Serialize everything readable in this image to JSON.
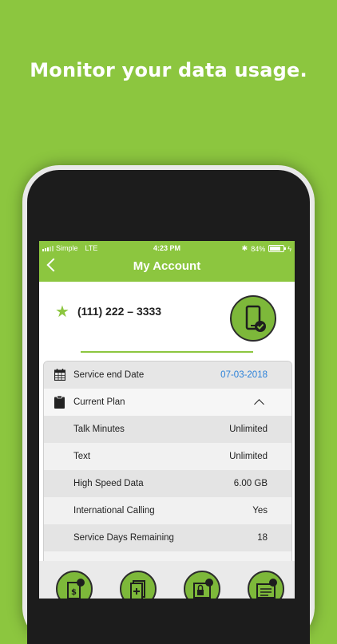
{
  "headline": "Monitor your data usage.",
  "status": {
    "carrier": "Simple",
    "network": "LTE",
    "time": "4:23 PM",
    "battery": "84%"
  },
  "header": {
    "title": "My Account"
  },
  "account": {
    "phone_number": "(111) 222 – 3333"
  },
  "details": {
    "service_end": {
      "label": "Service end Date",
      "value": "07-03-2018"
    },
    "current_plan": {
      "label": "Current Plan"
    },
    "items": [
      {
        "label": "Talk Minutes",
        "value": "Unlimited"
      },
      {
        "label": "Text",
        "value": "Unlimited"
      },
      {
        "label": "High Speed Data",
        "value": "6.00 GB"
      },
      {
        "label": "International Calling",
        "value": "Yes"
      },
      {
        "label": "Service Days Remaining",
        "value": "18"
      }
    ]
  },
  "icons": {
    "back": "chevron-left-icon",
    "favorite": "star-icon",
    "device": "phone-check-icon",
    "calendar": "calendar-icon",
    "plan": "clipboard-icon",
    "actions": [
      "add-funds-icon",
      "add-plan-icon",
      "lock-icon",
      "billing-icon"
    ]
  },
  "colors": {
    "brand_green": "#8cc63f",
    "date_blue": "#2a80d8"
  }
}
